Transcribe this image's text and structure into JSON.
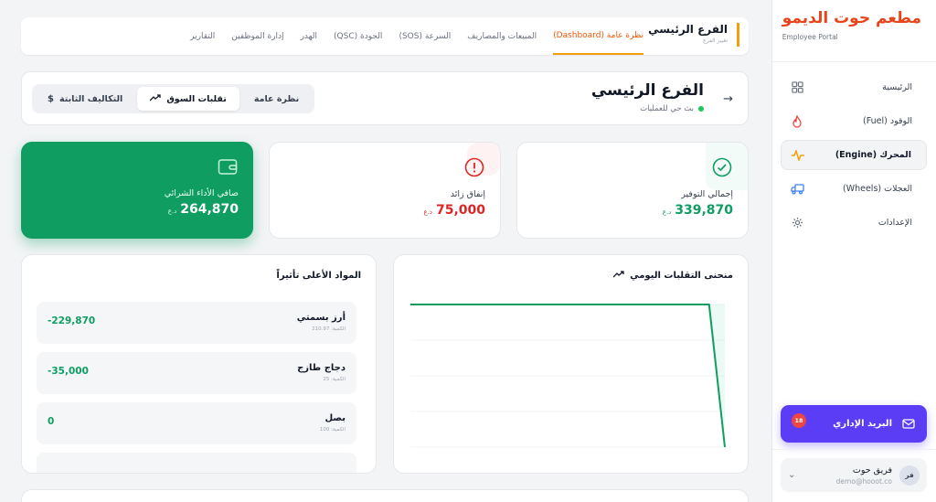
{
  "brand": {
    "title": "مطعم حوت الديمو",
    "subtitle": "Employee Portal"
  },
  "sidebar": {
    "items": [
      {
        "label": "الرئيسية",
        "icon": "grid-icon"
      },
      {
        "label": "الوقود (Fuel)",
        "icon": "flame-icon"
      },
      {
        "label": "المحرك (Engine)",
        "icon": "pulse-icon",
        "active": true
      },
      {
        "label": "العجلات (Wheels)",
        "icon": "truck-icon"
      },
      {
        "label": "الإعدادات",
        "icon": "gear-icon"
      }
    ],
    "mail": {
      "label": "البريد الإداري",
      "badge": "18"
    },
    "user": {
      "initials": "فر",
      "name": "فريق حوت",
      "email": "demo@hooot.co"
    }
  },
  "topbar": {
    "branch": "الفرع الرئيسي",
    "branch_sub": "تغيير الفرع",
    "tabs": [
      {
        "label": "نظرة عامة (Dashboard)",
        "active": true
      },
      {
        "label": "المبيعات والمصاريف"
      },
      {
        "label": "السرعة (SOS)"
      },
      {
        "label": "الجودة (QSC)"
      },
      {
        "label": "الهدر"
      },
      {
        "label": "إدارة الموظفين"
      },
      {
        "label": "التقارير"
      }
    ]
  },
  "header": {
    "title": "الفرع الرئيسي",
    "live_text": "بث حي للعمليات",
    "segments": [
      {
        "label": "نظرة عامة"
      },
      {
        "label": "تقلبات السوق",
        "active": true
      },
      {
        "label": "التكاليف الثابتة"
      }
    ]
  },
  "stats": {
    "savings": {
      "label": "إجمالي التوفير",
      "value": "339,870",
      "currency": "د.ع",
      "color": "#0f9d62"
    },
    "overspend": {
      "label": "إنفاق زائد",
      "value": "75,000",
      "currency": "د.ع",
      "color": "#dc2626"
    },
    "net": {
      "label": "صافي الأداء الشرائي",
      "value": "264,870",
      "currency": "د.ع",
      "color": "#0f9d62"
    }
  },
  "chart": {
    "title": "منحنى التقلبات اليومي"
  },
  "chart_data": {
    "type": "line",
    "title": "منحنى التقلبات اليومي",
    "xlabel": "",
    "ylabel": "",
    "series": [
      {
        "values": [
          0,
          0,
          0,
          0,
          0,
          0,
          0,
          0,
          0,
          0,
          0,
          0,
          0,
          0,
          0,
          0,
          0,
          0,
          0,
          0,
          -229870
        ]
      }
    ],
    "ylim": [
      -229870,
      0
    ],
    "grid": true,
    "color": "#0f9d62"
  },
  "items": {
    "title": "المواد الأعلى تأثيراً",
    "rows": [
      {
        "name": "أرز بسمتي",
        "qty": "الكمية: 210.97",
        "value": "-229,870"
      },
      {
        "name": "دجاج طازج",
        "qty": "الكمية: 25",
        "value": "-35,000"
      },
      {
        "name": "بصل",
        "qty": "الكمية: 100",
        "value": "0"
      }
    ]
  }
}
